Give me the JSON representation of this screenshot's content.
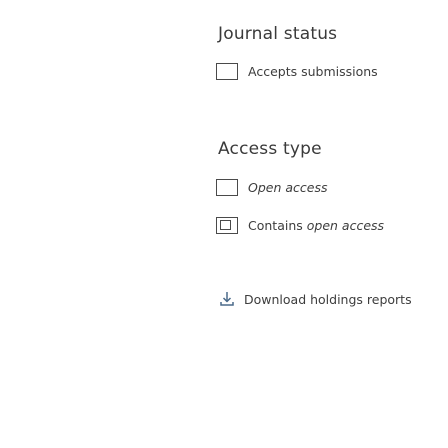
{
  "journal_status": {
    "heading": "Journal status",
    "options": [
      {
        "label": "Accepts submissions",
        "checked": false
      }
    ]
  },
  "access_type": {
    "heading": "Access type",
    "options": [
      {
        "label": "Open access",
        "checked": false
      },
      {
        "label_prefix": "Contains",
        "label_emphasis": "open access",
        "state": "indeterminate"
      }
    ]
  },
  "download": {
    "label": "Download holdings reports",
    "icon": "download-icon"
  }
}
